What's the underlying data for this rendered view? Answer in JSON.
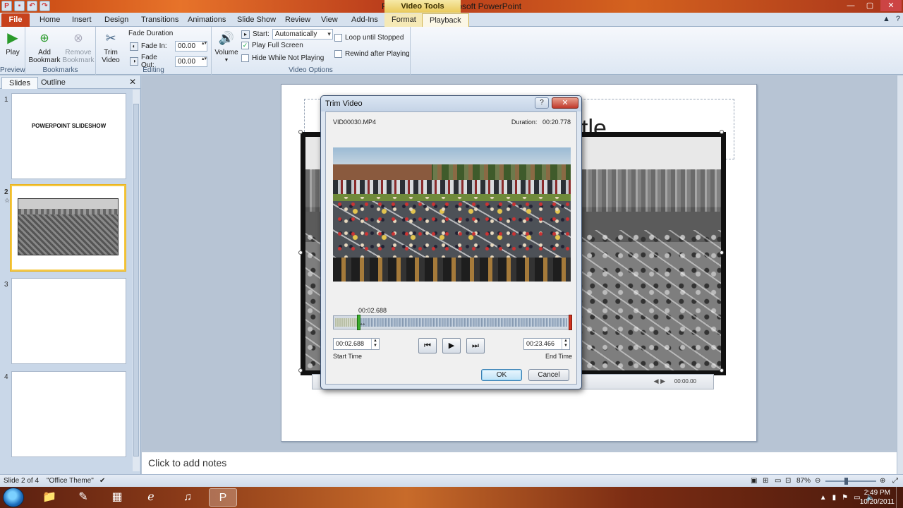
{
  "app": {
    "window_title": "Presentation1  -  Microsoft PowerPoint",
    "context_tab_title": "Video Tools"
  },
  "tabs": [
    "File",
    "Home",
    "Insert",
    "Design",
    "Transitions",
    "Animations",
    "Slide Show",
    "Review",
    "View",
    "Add-Ins",
    "Format",
    "Playback"
  ],
  "active_tab": "Playback",
  "ribbon": {
    "preview": {
      "play": "Play",
      "group": "Preview"
    },
    "bookmarks": {
      "add": "Add Bookmark",
      "remove": "Remove Bookmark",
      "group": "Bookmarks"
    },
    "editing": {
      "trim": "Trim Video",
      "fade_duration": "Fade Duration",
      "fade_in_label": "Fade In:",
      "fade_in_value": "00.00",
      "fade_out_label": "Fade Out:",
      "fade_out_value": "00.00",
      "group": "Editing"
    },
    "video_options": {
      "volume": "Volume",
      "start_label": "Start:",
      "start_value": "Automatically",
      "play_full_screen": "Play Full Screen",
      "play_full_screen_checked": true,
      "hide_while_not_playing": "Hide While Not Playing",
      "loop": "Loop until Stopped",
      "rewind": "Rewind after Playing",
      "group": "Video Options"
    }
  },
  "panel": {
    "tab_slides": "Slides",
    "tab_outline": "Outline",
    "slides": [
      {
        "num": "1",
        "title": "POWERPOINT SLIDESHOW"
      },
      {
        "num": "2",
        "title": ""
      },
      {
        "num": "3",
        "title": ""
      },
      {
        "num": "4",
        "title": ""
      }
    ],
    "selected_slide": "2"
  },
  "slide": {
    "title_fragment": "tle",
    "playbar_time": "00:00.00"
  },
  "notes_placeholder": "Click to add notes",
  "status": {
    "slide_count": "Slide 2 of 4",
    "theme": "\"Office Theme\"",
    "zoom": "87%"
  },
  "taskbar": {
    "time": "2:49 PM",
    "date": "10/20/2011"
  },
  "dialog": {
    "title": "Trim Video",
    "file_name": "VID00030.MP4",
    "duration_label": "Duration:",
    "duration_value": "00:20.778",
    "current_time": "00:02.688",
    "start_time": "00:02.688",
    "start_label": "Start Time",
    "end_time": "00:23.466",
    "end_label": "End Time",
    "ok": "OK",
    "cancel": "Cancel",
    "trim_start_fraction": 0.1
  }
}
